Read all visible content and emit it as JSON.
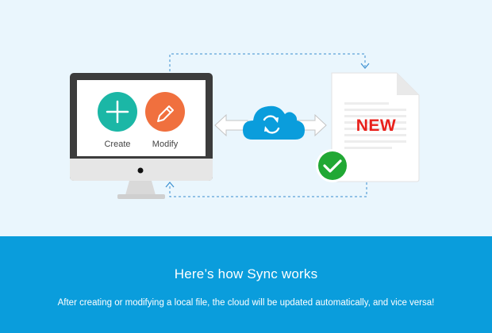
{
  "diagram": {
    "monitor": {
      "actions": [
        {
          "label": "Create",
          "icon": "plus-icon",
          "color": "#1bb7a6"
        },
        {
          "label": "Modify",
          "icon": "pencil-icon",
          "color": "#f0703e"
        }
      ]
    },
    "sync": {
      "icon": "cloud-sync-icon",
      "color": "#0a9ddc"
    },
    "document": {
      "badge": "NEW",
      "badge_color": "#e8201b",
      "status_icon": "check-icon",
      "status_color": "#21a834"
    }
  },
  "banner": {
    "background": "#0a9ddc",
    "title": "Here’s how Sync works",
    "subtitle": "After creating or modifying a local file, the cloud will be updated automatically, and vice versa!"
  }
}
